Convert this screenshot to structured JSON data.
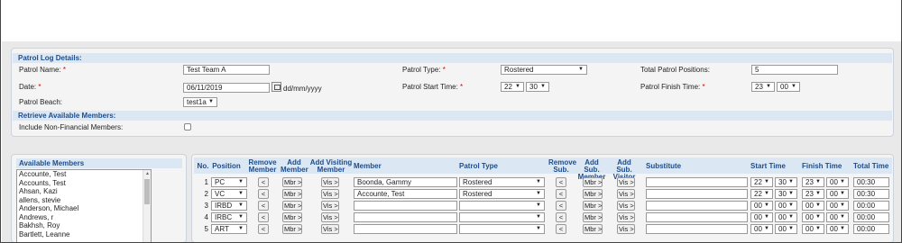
{
  "patrol_log": {
    "header": "Patrol Log Details:",
    "patrol_name_label": "Patrol Name:",
    "patrol_name_value": "Test Team A",
    "date_label": "Date:",
    "date_value": "06/11/2019",
    "date_format": "dd/mm/yyyy",
    "patrol_beach_label": "Patrol Beach:",
    "patrol_beach_value": "test1a",
    "patrol_type_label": "Patrol Type:",
    "patrol_type_value": "Rostered",
    "start_time_label": "Patrol Start Time:",
    "start_hour": "22",
    "start_min": "30",
    "total_positions_label": "Total Patrol Positions:",
    "total_positions_value": "5",
    "finish_time_label": "Patrol Finish Time:",
    "finish_hour": "23",
    "finish_min": "00",
    "required_marker": "*"
  },
  "retrieve": {
    "header": "Retrieve Available Members:",
    "non_financial_label": "Include Non-Financial Members:"
  },
  "available_members": {
    "header": "Available Members",
    "items": [
      "Accounte, Test",
      "Accounts, Test",
      "Ahsan, Kazi",
      "allens, stevie",
      "Anderson, Michael",
      "Andrews, r",
      "Bakhsh, Roy",
      "Bartlett, Leanne"
    ]
  },
  "roster": {
    "headers": {
      "no": "No.",
      "position": "Position",
      "remove_member": "Remove Member",
      "add_member": "Add Member",
      "add_visiting": "Add Visiting Member",
      "member": "Member",
      "patrol_type": "Patrol Type",
      "remove_sub": "Remove Sub.",
      "add_sub_member": "Add Sub. Member",
      "add_sub_visitor": "Add Sub. Visitor",
      "substitute": "Substitute",
      "start_time": "Start Time",
      "finish_time": "Finish Time",
      "total_time": "Total Time"
    },
    "button_labels": {
      "remove": "<",
      "member": "Mbr >",
      "visitor": "Vis >"
    },
    "rows": [
      {
        "no": "1",
        "position": "PC",
        "member": "Boonda, Gammy",
        "patrol_type": "Rostered",
        "sh": "22",
        "sm": "30",
        "fh": "23",
        "fm": "00",
        "total": "00:30"
      },
      {
        "no": "2",
        "position": "VC",
        "member": "Accounte, Test",
        "patrol_type": "Rostered",
        "sh": "22",
        "sm": "30",
        "fh": "23",
        "fm": "00",
        "total": "00:30"
      },
      {
        "no": "3",
        "position": "IRBD",
        "member": "",
        "patrol_type": "",
        "sh": "00",
        "sm": "00",
        "fh": "00",
        "fm": "00",
        "total": "00:00"
      },
      {
        "no": "4",
        "position": "IRBC",
        "member": "",
        "patrol_type": "",
        "sh": "00",
        "sm": "00",
        "fh": "00",
        "fm": "00",
        "total": "00:00"
      },
      {
        "no": "5",
        "position": "ART",
        "member": "",
        "patrol_type": "",
        "sh": "00",
        "sm": "00",
        "fh": "00",
        "fm": "00",
        "total": "00:00"
      }
    ]
  }
}
